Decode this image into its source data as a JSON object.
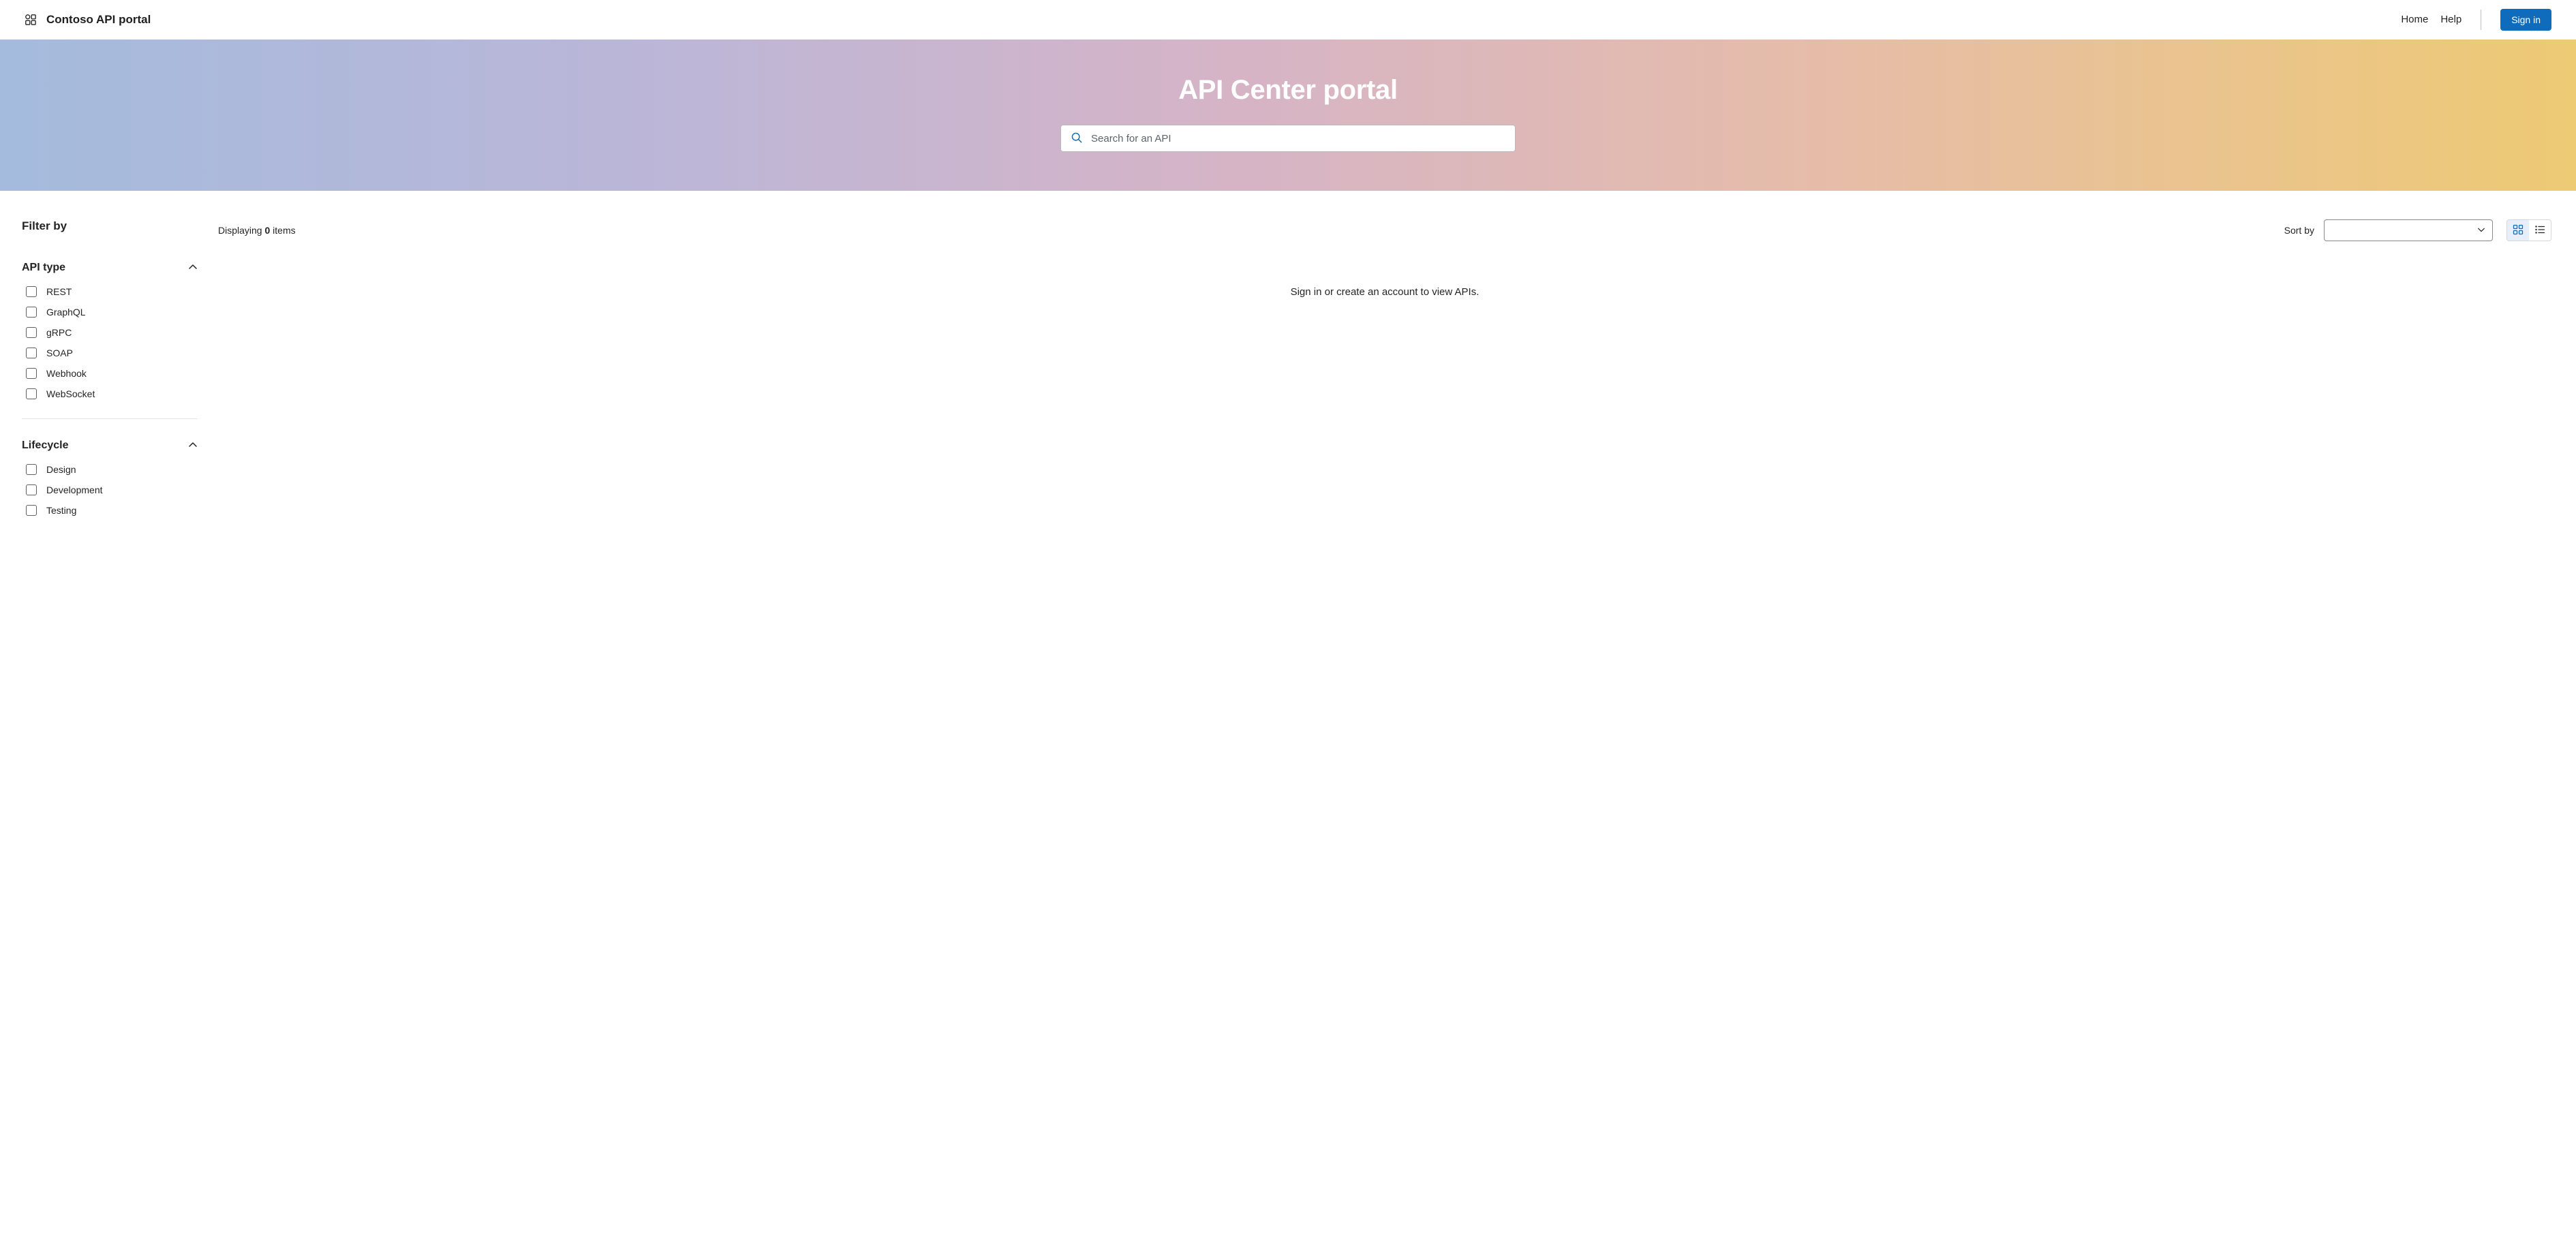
{
  "header": {
    "app_name": "Contoso API portal",
    "nav": {
      "home": "Home",
      "help": "Help"
    },
    "signin": "Sign in"
  },
  "hero": {
    "title": "API Center portal",
    "search_placeholder": "Search for an API"
  },
  "sidebar": {
    "title": "Filter by",
    "sections": [
      {
        "title": "API type",
        "options": [
          {
            "label": "REST"
          },
          {
            "label": "GraphQL"
          },
          {
            "label": "gRPC"
          },
          {
            "label": "SOAP"
          },
          {
            "label": "Webhook"
          },
          {
            "label": "WebSocket"
          }
        ]
      },
      {
        "title": "Lifecycle",
        "options": [
          {
            "label": "Design"
          },
          {
            "label": "Development"
          },
          {
            "label": "Testing"
          }
        ]
      }
    ]
  },
  "content": {
    "display_prefix": "Displaying ",
    "display_count": "0",
    "display_suffix": " items",
    "sort_label": "Sort by",
    "sort_value": "",
    "empty": "Sign in or create an account to view APIs."
  }
}
